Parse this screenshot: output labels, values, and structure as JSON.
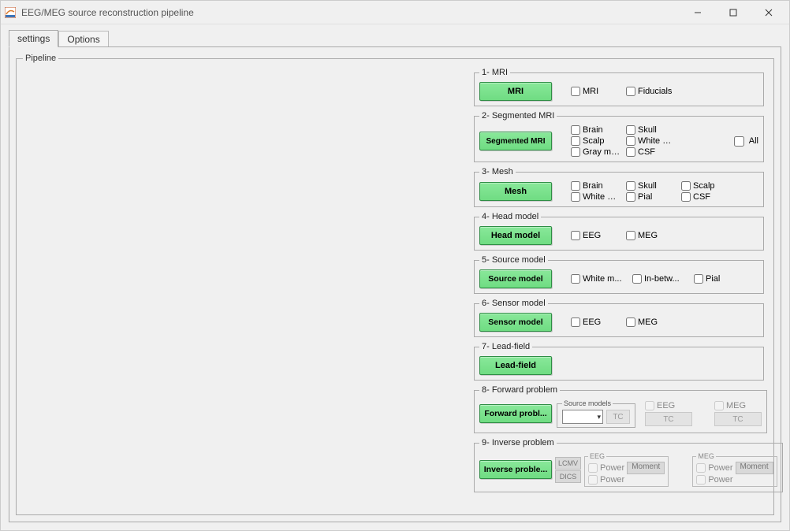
{
  "window": {
    "title": "EEG/MEG source reconstruction pipeline"
  },
  "tabs": {
    "settings": "settings",
    "options": "Options"
  },
  "pipeline_legend": "Pipeline",
  "steps": {
    "s1": {
      "legend": "1- MRI",
      "button": "MRI",
      "checks": [
        "MRI",
        "Fiducials"
      ]
    },
    "s2": {
      "legend": "2- Segmented MRI",
      "button": "Segmented MRI",
      "checks_row1": [
        "Brain",
        "Skull",
        "Scalp"
      ],
      "checks_row2": [
        "White m...",
        "Gray ma...",
        "CSF"
      ],
      "all_label": "All"
    },
    "s3": {
      "legend": "3- Mesh",
      "button": "Mesh",
      "checks_row1": [
        "Brain",
        "Skull",
        "Scalp"
      ],
      "checks_row2": [
        "White m...",
        "Pial",
        "CSF"
      ]
    },
    "s4": {
      "legend": "4- Head model",
      "button": "Head model",
      "checks": [
        "EEG",
        "MEG"
      ]
    },
    "s5": {
      "legend": "5- Source model",
      "button": "Source model",
      "checks": [
        "White m...",
        "In-betw...",
        "Pial"
      ]
    },
    "s6": {
      "legend": "6- Sensor model",
      "button": "Sensor model",
      "checks": [
        "EEG",
        "MEG"
      ]
    },
    "s7": {
      "legend": "7- Lead-field",
      "button": "Lead-field"
    },
    "s8": {
      "legend": "8- Forward problem",
      "button": "Forward probl...",
      "sm_legend": "Source models",
      "tc": "TC",
      "eeg": "EEG",
      "meg": "MEG"
    },
    "s9": {
      "legend": "9- Inverse problem",
      "button": "Inverse proble...",
      "lcmv": "LCMV",
      "dics": "DICS",
      "eeg_legend": "EEG",
      "meg_legend": "MEG",
      "power": "Power",
      "moment": "Moment"
    }
  }
}
